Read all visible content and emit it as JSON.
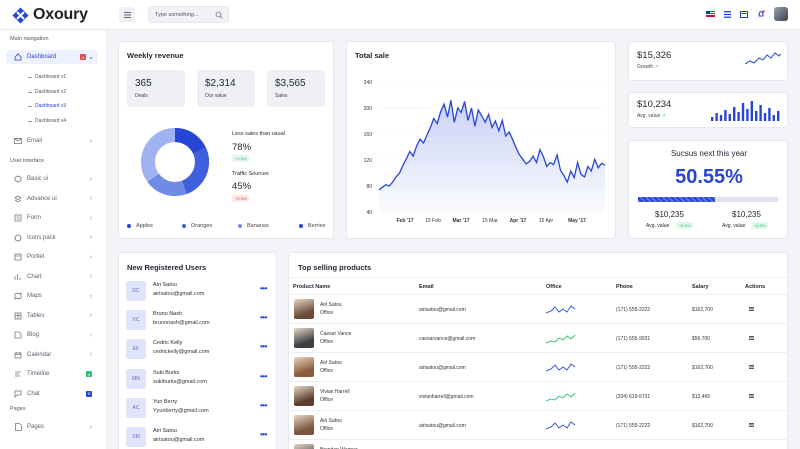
{
  "app": {
    "name": "Oxoury"
  },
  "search": {
    "placeholder": "Type something..."
  },
  "sidebar": {
    "main_nav_title": "Main navigation",
    "dashboard": {
      "label": "Dashboard",
      "badge": "4"
    },
    "dashboard_sub": [
      "Dashboard v1",
      "Dashboard v2",
      "Dashboard v3",
      "Dashboard v4"
    ],
    "email": "Email",
    "ui_title": "User interface",
    "items": [
      {
        "label": "Basic ui",
        "icon": "cube-icon"
      },
      {
        "label": "Advance ui",
        "icon": "layers-icon"
      },
      {
        "label": "Form",
        "icon": "form-icon"
      },
      {
        "label": "Icons pack",
        "icon": "icons-pack-icon"
      },
      {
        "label": "Portlet",
        "icon": "portlet-icon"
      },
      {
        "label": "Chart",
        "icon": "chart-icon"
      },
      {
        "label": "Maps",
        "icon": "map-icon"
      },
      {
        "label": "Tables",
        "icon": "table-icon"
      },
      {
        "label": "Blog",
        "icon": "blog-icon"
      },
      {
        "label": "Calendar",
        "icon": "calendar-icon"
      },
      {
        "label": "Timeline",
        "icon": "timeline-icon",
        "badge": "4"
      },
      {
        "label": "Chat",
        "icon": "chat-icon",
        "badge": "5"
      }
    ],
    "pages_title": "Pages",
    "pages": "Pages"
  },
  "weekly": {
    "title": "Weekly revenue",
    "stats": [
      {
        "value": "365",
        "label": "Deals"
      },
      {
        "value": "$2,314",
        "label": "Our value"
      },
      {
        "value": "$3,565",
        "label": "Sales"
      }
    ],
    "less_sales_label": "Less sales than usual",
    "less_sales_value": "78%",
    "less_sales_badge": "+0.5%",
    "traffic_label": "Traffic Sources",
    "traffic_value": "45%",
    "traffic_badge": "+0.5%",
    "legend": [
      "Apples",
      "Oranges",
      "Bananas",
      "Berries"
    ]
  },
  "total_sale": {
    "title": "Total sale"
  },
  "chart_data": {
    "type": "area",
    "title": "Total sale",
    "x_ticks": [
      "Feb '17",
      "15 Feb",
      "Mar '17",
      "15 Mar",
      "Apr '17",
      "15 Apr",
      "May '17"
    ],
    "y_ticks": [
      40,
      80,
      120,
      160,
      200,
      240
    ],
    "ylim": [
      40,
      240
    ],
    "series": [
      {
        "values": [
          74,
          78,
          82,
          80,
          86,
          94,
          100,
          112,
          122,
          133,
          126,
          142,
          152,
          146,
          158,
          170,
          184,
          176,
          194,
          206,
          186,
          212,
          178,
          200,
          193,
          210,
          181,
          200,
          172,
          197,
          188,
          178,
          190,
          170,
          180,
          165,
          181,
          157,
          163,
          152,
          139,
          128,
          121,
          114,
          118,
          126,
          116,
          136,
          125,
          110,
          116,
          113,
          128,
          104,
          96,
          86,
          103,
          93,
          116,
          98,
          94,
          110,
          103,
          121,
          108,
          115,
          112
        ]
      }
    ]
  },
  "growth": {
    "value": "$15,326",
    "label": "Growth"
  },
  "avg_value": {
    "value": "$10,234",
    "label": "Avg. value"
  },
  "success": {
    "title": "Sucsus next this year",
    "percent": "50.55%",
    "progress": 0.55,
    "left_value": "$10,235",
    "left_label": "Avg. value",
    "left_badge": "+6.5%",
    "right_value": "$10,235",
    "right_label": "Avg. value",
    "right_badge": "+6.5%"
  },
  "new_users": {
    "title": "New Registered Users",
    "users": [
      {
        "initials": "DC",
        "name": "Airi Satou",
        "email": "airisatou@gmail.com"
      },
      {
        "initials": "VC",
        "name": "Bruno Nash",
        "email": "brunonash@gmail.com"
      },
      {
        "initials": "EF",
        "name": "Cedric Kelly",
        "email": "cedrickelly@gmail.com"
      },
      {
        "initials": "MN",
        "name": "Suki Burks",
        "email": "sukiburks@gmail.com"
      },
      {
        "initials": "AC",
        "name": "Yuri Berry",
        "email": "Yyuriberry@gmail.com"
      },
      {
        "initials": "SM",
        "name": "Airi Satou",
        "email": "airisatou@gmail.com"
      }
    ]
  },
  "top_products": {
    "title": "Top selling products",
    "columns": [
      "Product Name",
      "Email",
      "Office",
      "Phone",
      "Salary",
      "Actions"
    ],
    "rows": [
      {
        "name": "Airi Satou",
        "office": "Office",
        "email": "airisatou@gmail.com",
        "phone": "(171) 555-2222",
        "salary": "$162,700",
        "trend": "blue"
      },
      {
        "name": "Caesar Vance",
        "office": "Office",
        "email": "caesarvance@gmail.com",
        "phone": "(171) 555-9931",
        "salary": "$56,700",
        "trend": "green"
      },
      {
        "name": "Airi Satou",
        "office": "Office",
        "email": "airisatou@gmail.com",
        "phone": "(171) 555-2222",
        "salary": "$162,700",
        "trend": "blue"
      },
      {
        "name": "Vivian Harrell",
        "office": "Office",
        "email": "vivianharrell@gmail.com",
        "phone": "(204) 619-5731",
        "salary": "$13,465",
        "trend": "green"
      },
      {
        "name": "Airi Satou",
        "office": "Office",
        "email": "airisatou@gmail.com",
        "phone": "(171) 555-2222",
        "salary": "$162,700",
        "trend": "blue"
      },
      {
        "name": "Brenden Wagner",
        "office": "",
        "email": "",
        "phone": "",
        "salary": "",
        "trend": "blue"
      }
    ]
  },
  "colors": {
    "accent": "#2746d6",
    "green": "#2fbf71",
    "red": "#e04b4b"
  }
}
